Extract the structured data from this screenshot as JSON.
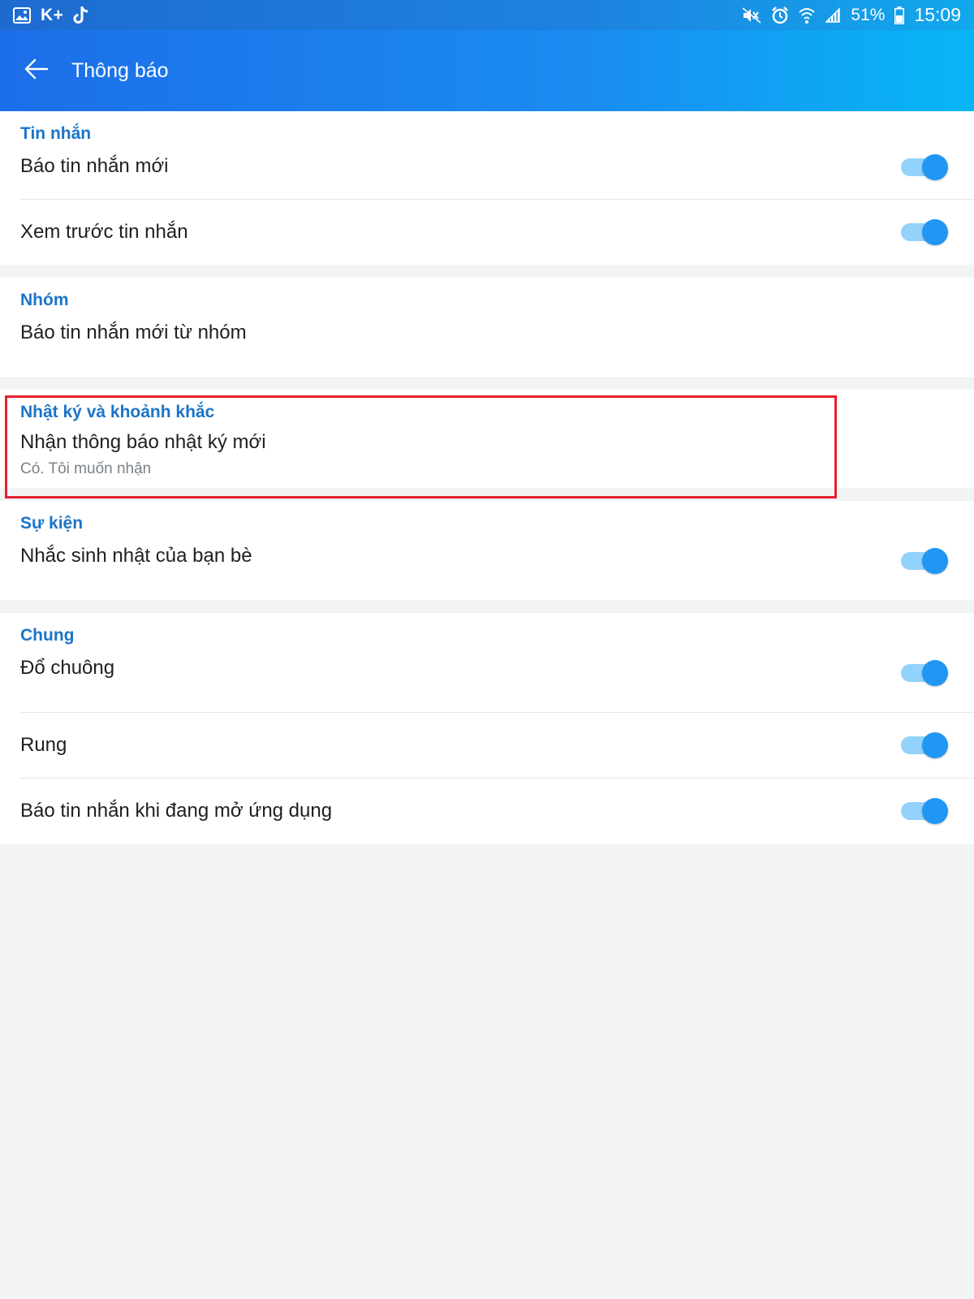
{
  "status_bar": {
    "app_text": "K+",
    "battery": "51%",
    "time": "15:09",
    "icons": [
      "gallery-icon",
      "tiktok-icon",
      "mute-icon",
      "alarm-icon",
      "wifi-icon",
      "signal-icon",
      "battery-icon"
    ]
  },
  "header": {
    "title": "Thông báo",
    "back_icon": "arrow-left-icon"
  },
  "sections": {
    "messages": {
      "title": "Tin nhắn",
      "items": [
        {
          "label": "Báo tin nhắn mới",
          "toggle": true
        },
        {
          "label": "Xem trước tin nhắn",
          "toggle": true
        }
      ]
    },
    "group": {
      "title": "Nhóm",
      "items": [
        {
          "label": "Báo tin nhắn mới từ nhóm"
        }
      ]
    },
    "diary": {
      "title": "Nhật ký và khoảnh khắc",
      "items": [
        {
          "label": "Nhận thông báo nhật ký mới",
          "sublabel": "Có. Tôi muốn nhận"
        }
      ]
    },
    "events": {
      "title": "Sự kiện",
      "items": [
        {
          "label": "Nhắc sinh nhật của bạn bè",
          "toggle": true
        }
      ]
    },
    "general": {
      "title": "Chung",
      "items": [
        {
          "label": "Đổ chuông",
          "toggle": true
        },
        {
          "label": "Rung",
          "toggle": true
        },
        {
          "label": "Báo tin nhắn khi đang mở ứng dụng",
          "toggle": true
        }
      ]
    }
  },
  "colors": {
    "accent": "#2196f3",
    "section_title": "#1b74c8",
    "highlight_border": "#e5202e"
  }
}
